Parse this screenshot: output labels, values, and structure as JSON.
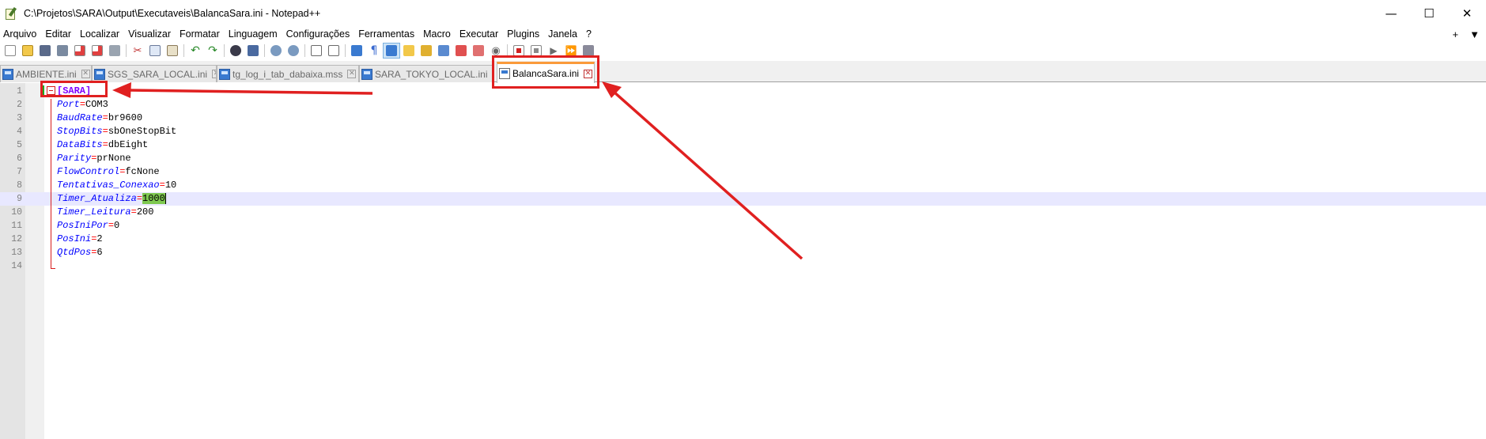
{
  "window": {
    "title": "C:\\Projetos\\SARA\\Output\\Executaveis\\BalancaSara.ini - Notepad++",
    "minimize_glyph": "—",
    "maximize_glyph": "☐",
    "close_glyph": "✕"
  },
  "menu": {
    "items": [
      "Arquivo",
      "Editar",
      "Localizar",
      "Visualizar",
      "Formatar",
      "Linguagem",
      "Configurações",
      "Ferramentas",
      "Macro",
      "Executar",
      "Plugins",
      "Janela",
      "?"
    ],
    "right_plus": "+",
    "right_arrow": "▼"
  },
  "tabs": [
    {
      "label": "AMBIENTE.ini",
      "active": false
    },
    {
      "label": "SGS_SARA_LOCAL.ini",
      "active": false
    },
    {
      "label": "tg_log_i_tab_dabaixa.mss",
      "active": false
    },
    {
      "label": "SARA_TOKYO_LOCAL.ini",
      "active": false
    },
    {
      "label": "BalancaSara.ini",
      "active": true
    }
  ],
  "editor": {
    "lines": [
      {
        "n": "1",
        "section": "[SARA]"
      },
      {
        "n": "2",
        "key": "Port",
        "value": "COM3"
      },
      {
        "n": "3",
        "key": "BaudRate",
        "value": "br9600"
      },
      {
        "n": "4",
        "key": "StopBits",
        "value": "sbOneStopBit"
      },
      {
        "n": "5",
        "key": "DataBits",
        "value": "dbEight"
      },
      {
        "n": "6",
        "key": "Parity",
        "value": "prNone"
      },
      {
        "n": "7",
        "key": "FlowControl",
        "value": "fcNone"
      },
      {
        "n": "8",
        "key": "Tentativas_Conexao",
        "value": "10"
      },
      {
        "n": "9",
        "key": "Timer_Atualiza",
        "value": "1000"
      },
      {
        "n": "10",
        "key": "Timer_Leitura",
        "value": "200"
      },
      {
        "n": "11",
        "key": "PosIniPor",
        "value": "0"
      },
      {
        "n": "12",
        "key": "PosIni",
        "value": "2"
      },
      {
        "n": "13",
        "key": "QtdPos",
        "value": "6"
      },
      {
        "n": "14"
      }
    ],
    "equals": "=",
    "current_line": 9
  },
  "colors": {
    "annotation_red": "#e02020",
    "section_color": "#8000ff",
    "key_color": "#0000ff",
    "operator_color": "#ff0000",
    "selection_highlight": "#7ec850",
    "current_line_bg": "#e8e8ff",
    "active_tab_accent": "#fa9a3a"
  },
  "icons": [
    "new-file-icon",
    "open-file-icon",
    "save-icon",
    "save-all-icon",
    "close-icon",
    "close-all-icon",
    "print-icon",
    "cut-icon",
    "copy-icon",
    "paste-icon",
    "undo-icon",
    "redo-icon",
    "find-icon",
    "replace-icon",
    "zoom-in-icon",
    "zoom-out-icon",
    "sync-vertical-icon",
    "sync-horizontal-icon",
    "word-wrap-icon",
    "show-all-chars-icon",
    "indent-guide-icon",
    "user-lang-icon",
    "doc-map-icon",
    "function-list-icon",
    "folder-workspace-icon",
    "monitoring-icon",
    "record-macro-icon",
    "stop-macro-icon",
    "play-macro-icon",
    "run-macro-multiple-icon",
    "save-macro-icon"
  ]
}
